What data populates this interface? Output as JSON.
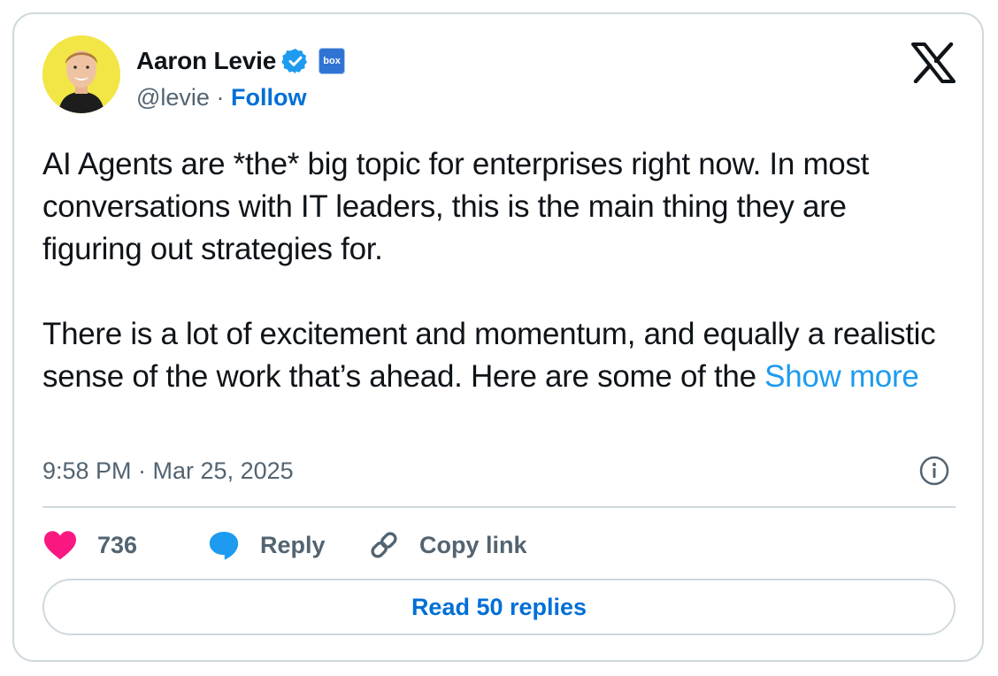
{
  "author": {
    "display_name": "Aaron Levie",
    "handle": "@levie",
    "separator": "·",
    "follow_label": "Follow",
    "affiliation_badge": "box",
    "verified_color": "#1d9bf0",
    "avatar_bg": "#f2e646"
  },
  "icons": {
    "platform_logo": "x-logo-icon",
    "verified": "verified-badge-icon",
    "affiliation": "box-logo-icon",
    "info": "info-icon",
    "like": "heart-icon",
    "reply": "speech-bubble-icon",
    "copy": "link-icon"
  },
  "tweet": {
    "paragraph1": "AI Agents are *the* big topic for enterprises right now. In most conversations with IT leaders, this is the main thing they are figuring out strategies for.",
    "paragraph2": "There is a lot of excitement and momentum, and equally a realistic sense of the work that’s ahead. Here are some of the",
    "show_more": "Show more",
    "timestamp": "9:58 PM · Mar 25, 2025"
  },
  "actions": {
    "like_count": "736",
    "reply_label": "Reply",
    "copy_link_label": "Copy link",
    "read_replies_label": "Read 50 replies"
  },
  "colors": {
    "link": "#006fd6",
    "show_more": "#1d9bf0",
    "like": "#f91880",
    "reply": "#1d9bf0",
    "secondary_text": "#536471",
    "border": "#cfd9de"
  }
}
